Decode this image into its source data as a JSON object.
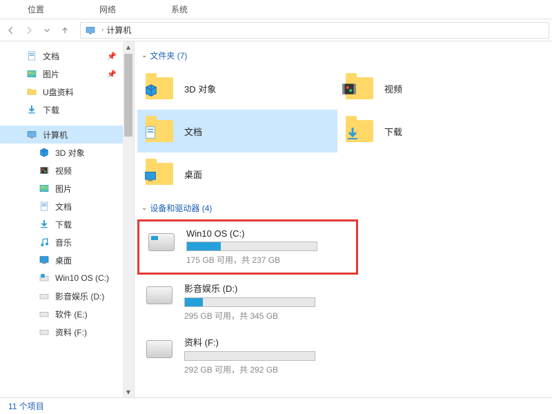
{
  "tabs": [
    "位置",
    "网络",
    "系统"
  ],
  "breadcrumb": {
    "current": "计算机"
  },
  "sidebar": {
    "items": [
      {
        "label": "文档",
        "icon": "doc",
        "pinned": true
      },
      {
        "label": "图片",
        "icon": "pic",
        "pinned": true
      },
      {
        "label": "U盘资料",
        "icon": "folder",
        "pinned": false
      },
      {
        "label": "下载",
        "icon": "download",
        "pinned": false
      },
      {
        "label": "计算机",
        "icon": "computer",
        "pinned": false,
        "selected": true
      },
      {
        "label": "3D 对象",
        "icon": "3d",
        "sub": true
      },
      {
        "label": "视频",
        "icon": "video",
        "sub": true
      },
      {
        "label": "图片",
        "icon": "pic",
        "sub": true
      },
      {
        "label": "文档",
        "icon": "doc",
        "sub": true
      },
      {
        "label": "下载",
        "icon": "download",
        "sub": true
      },
      {
        "label": "音乐",
        "icon": "music",
        "sub": true
      },
      {
        "label": "桌面",
        "icon": "desktop",
        "sub": true
      },
      {
        "label": "Win10 OS  (C:)",
        "icon": "osdisk",
        "sub": true
      },
      {
        "label": "影音娱乐 (D:)",
        "icon": "disk",
        "sub": true
      },
      {
        "label": "软件 (E:)",
        "icon": "disk",
        "sub": true
      },
      {
        "label": "资料 (F:)",
        "icon": "disk",
        "sub": true
      }
    ]
  },
  "groups": {
    "folders": {
      "header": "文件夹 (7)",
      "items": [
        {
          "name": "3D 对象",
          "icon": "3d"
        },
        {
          "name": "视频",
          "icon": "video"
        },
        {
          "name": "文档",
          "icon": "doc",
          "selected": true
        },
        {
          "name": "下载",
          "icon": "download"
        },
        {
          "name": "桌面",
          "icon": "desktop"
        }
      ]
    },
    "drives": {
      "header": "设备和驱动器 (4)",
      "items": [
        {
          "name": "Win10 OS  (C:)",
          "free": 175,
          "total": 237,
          "status": "175 GB 可用，共 237 GB",
          "highlighted": true,
          "os": true
        },
        {
          "name": "影音娱乐 (D:)",
          "free": 295,
          "total": 345,
          "status": "295 GB 可用，共 345 GB"
        },
        {
          "name": "资料 (F:)",
          "free": 292,
          "total": 292,
          "status": "292 GB 可用，共 292 GB"
        }
      ]
    }
  },
  "statusbar": {
    "text": "11 个项目"
  }
}
